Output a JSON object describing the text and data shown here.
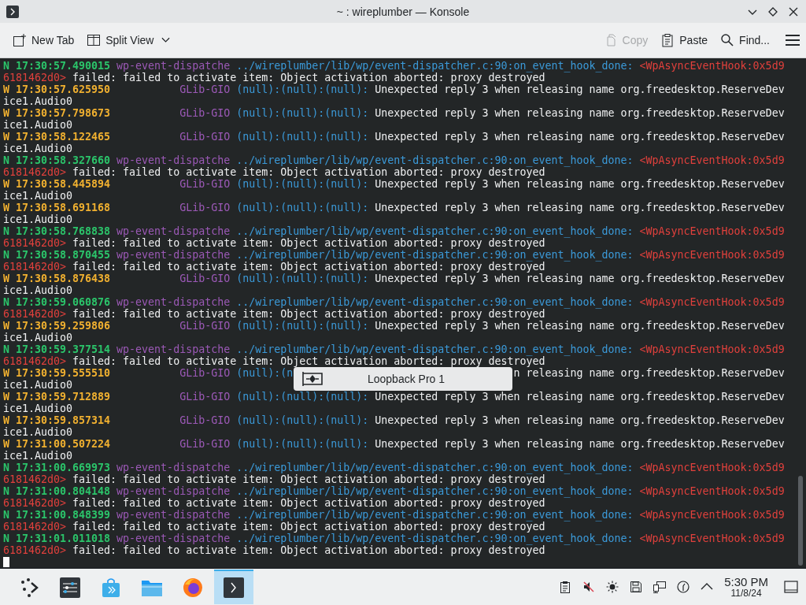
{
  "window": {
    "title": "~ : wireplumber — Konsole"
  },
  "toolbar": {
    "left": [
      {
        "label": "New Tab",
        "kind": "new-tab"
      },
      {
        "label": "Split View",
        "kind": "split-view"
      }
    ],
    "right": [
      {
        "label": "Copy",
        "kind": "copy",
        "disabled": true
      },
      {
        "label": "Paste",
        "kind": "paste",
        "disabled": false
      },
      {
        "label": "Find...",
        "kind": "find",
        "disabled": false
      }
    ]
  },
  "log": [
    {
      "kind": "event",
      "level": "N",
      "time": "17:30:57.490015",
      "source": "wp-event-dispatche",
      "location": "../wireplumber/lib/wp/event-dispatcher.c:90:on_event_hook_done:",
      "object_head": "<WpAsyncEventHook:0x5d9",
      "object_tail": "6181462d0>",
      "message": "failed: failed to activate item: Object activation aborted: proxy destroyed"
    },
    {
      "kind": "warning",
      "level": "W",
      "time": "17:30:57.625950",
      "source": "GLib-GIO",
      "location": "(null):(null):(null):",
      "message": "Unexpected reply 3 when releasing name org.freedesktop.ReserveDev",
      "message_tail": "ice1.Audio0"
    },
    {
      "kind": "warning",
      "level": "W",
      "time": "17:30:57.798673",
      "source": "GLib-GIO",
      "location": "(null):(null):(null):",
      "message": "Unexpected reply 3 when releasing name org.freedesktop.ReserveDev",
      "message_tail": "ice1.Audio0"
    },
    {
      "kind": "warning",
      "level": "W",
      "time": "17:30:58.122465",
      "source": "GLib-GIO",
      "location": "(null):(null):(null):",
      "message": "Unexpected reply 3 when releasing name org.freedesktop.ReserveDev",
      "message_tail": "ice1.Audio0"
    },
    {
      "kind": "event",
      "level": "N",
      "time": "17:30:58.327660",
      "source": "wp-event-dispatche",
      "location": "../wireplumber/lib/wp/event-dispatcher.c:90:on_event_hook_done:",
      "object_head": "<WpAsyncEventHook:0x5d9",
      "object_tail": "6181462d0>",
      "message": "failed: failed to activate item: Object activation aborted: proxy destroyed"
    },
    {
      "kind": "warning",
      "level": "W",
      "time": "17:30:58.445894",
      "source": "GLib-GIO",
      "location": "(null):(null):(null):",
      "message": "Unexpected reply 3 when releasing name org.freedesktop.ReserveDev",
      "message_tail": "ice1.Audio0"
    },
    {
      "kind": "warning",
      "level": "W",
      "time": "17:30:58.691168",
      "source": "GLib-GIO",
      "location": "(null):(null):(null):",
      "message": "Unexpected reply 3 when releasing name org.freedesktop.ReserveDev",
      "message_tail": "ice1.Audio0"
    },
    {
      "kind": "event",
      "level": "N",
      "time": "17:30:58.768838",
      "source": "wp-event-dispatche",
      "location": "../wireplumber/lib/wp/event-dispatcher.c:90:on_event_hook_done:",
      "object_head": "<WpAsyncEventHook:0x5d9",
      "object_tail": "6181462d0>",
      "message": "failed: failed to activate item: Object activation aborted: proxy destroyed"
    },
    {
      "kind": "event",
      "level": "N",
      "time": "17:30:58.870455",
      "source": "wp-event-dispatche",
      "location": "../wireplumber/lib/wp/event-dispatcher.c:90:on_event_hook_done:",
      "object_head": "<WpAsyncEventHook:0x5d9",
      "object_tail": "6181462d0>",
      "message": "failed: failed to activate item: Object activation aborted: proxy destroyed"
    },
    {
      "kind": "warning",
      "level": "W",
      "time": "17:30:58.876438",
      "source": "GLib-GIO",
      "location": "(null):(null):(null):",
      "message": "Unexpected reply 3 when releasing name org.freedesktop.ReserveDev",
      "message_tail": "ice1.Audio0"
    },
    {
      "kind": "event",
      "level": "N",
      "time": "17:30:59.060876",
      "source": "wp-event-dispatche",
      "location": "../wireplumber/lib/wp/event-dispatcher.c:90:on_event_hook_done:",
      "object_head": "<WpAsyncEventHook:0x5d9",
      "object_tail": "6181462d0>",
      "message": "failed: failed to activate item: Object activation aborted: proxy destroyed"
    },
    {
      "kind": "warning",
      "level": "W",
      "time": "17:30:59.259806",
      "source": "GLib-GIO",
      "location": "(null):(null):(null):",
      "message": "Unexpected reply 3 when releasing name org.freedesktop.ReserveDev",
      "message_tail": "ice1.Audio0"
    },
    {
      "kind": "event",
      "level": "N",
      "time": "17:30:59.377514",
      "source": "wp-event-dispatche",
      "location": "../wireplumber/lib/wp/event-dispatcher.c:90:on_event_hook_done:",
      "object_head": "<WpAsyncEventHook:0x5d9",
      "object_tail": "6181462d0>",
      "message": "failed: failed to activate item: Object activation aborted: proxy destroyed"
    },
    {
      "kind": "warning",
      "level": "W",
      "time": "17:30:59.555510",
      "source": "GLib-GIO",
      "location": "(null):(n",
      "covered": true,
      "message": "n releasing name org.freedesktop.ReserveDev",
      "message_tail": "ice1.Audio0"
    },
    {
      "kind": "warning",
      "level": "W",
      "time": "17:30:59.712889",
      "source": "GLib-GIO",
      "location": "(null):(null):(null):",
      "message": "Unexpected reply 3 when releasing name org.freedesktop.ReserveDev",
      "message_tail": "ice1.Audio0"
    },
    {
      "kind": "warning",
      "level": "W",
      "time": "17:30:59.857314",
      "source": "GLib-GIO",
      "location": "(null):(null):(null):",
      "message": "Unexpected reply 3 when releasing name org.freedesktop.ReserveDev",
      "message_tail": "ice1.Audio0"
    },
    {
      "kind": "warning",
      "level": "W",
      "time": "17:31:00.507224",
      "source": "GLib-GIO",
      "location": "(null):(null):(null):",
      "message": "Unexpected reply 3 when releasing name org.freedesktop.ReserveDev",
      "message_tail": "ice1.Audio0"
    },
    {
      "kind": "event",
      "level": "N",
      "time": "17:31:00.669973",
      "source": "wp-event-dispatche",
      "location": "../wireplumber/lib/wp/event-dispatcher.c:90:on_event_hook_done:",
      "object_head": "<WpAsyncEventHook:0x5d9",
      "object_tail": "6181462d0>",
      "message": "failed: failed to activate item: Object activation aborted: proxy destroyed"
    },
    {
      "kind": "event",
      "level": "N",
      "time": "17:31:00.804148",
      "source": "wp-event-dispatche",
      "location": "../wireplumber/lib/wp/event-dispatcher.c:90:on_event_hook_done:",
      "object_head": "<WpAsyncEventHook:0x5d9",
      "object_tail": "6181462d0>",
      "message": "failed: failed to activate item: Object activation aborted: proxy destroyed"
    },
    {
      "kind": "event",
      "level": "N",
      "time": "17:31:00.848399",
      "source": "wp-event-dispatche",
      "location": "../wireplumber/lib/wp/event-dispatcher.c:90:on_event_hook_done:",
      "object_head": "<WpAsyncEventHook:0x5d9",
      "object_tail": "6181462d0>",
      "message": "failed: failed to activate item: Object activation aborted: proxy destroyed"
    },
    {
      "kind": "event",
      "level": "N",
      "time": "17:31:01.011018",
      "source": "wp-event-dispatche",
      "location": "../wireplumber/lib/wp/event-dispatcher.c:90:on_event_hook_done:",
      "object_head": "<WpAsyncEventHook:0x5d9",
      "object_tail": "6181462d0>",
      "message": "failed: failed to activate item: Object activation aborted: proxy destroyed"
    }
  ],
  "osd": {
    "label": "Loopback Pro 1"
  },
  "taskbar": {
    "apps": [
      {
        "kind": "launcher",
        "selected": false
      },
      {
        "kind": "settings",
        "selected": false
      },
      {
        "kind": "store",
        "selected": false
      },
      {
        "kind": "files",
        "selected": false
      },
      {
        "kind": "browser",
        "selected": false
      },
      {
        "kind": "terminal",
        "selected": true
      }
    ],
    "tray": [
      {
        "kind": "clipboard"
      },
      {
        "kind": "volume-muted"
      },
      {
        "kind": "brightness"
      },
      {
        "kind": "disk"
      },
      {
        "kind": "network"
      },
      {
        "kind": "gauge"
      },
      {
        "kind": "expand"
      }
    ],
    "clock": {
      "time": "5:30 PM",
      "date": "11/8/24"
    }
  }
}
